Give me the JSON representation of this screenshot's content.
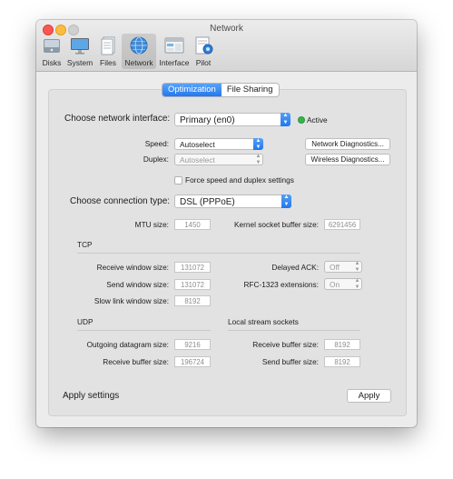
{
  "window": {
    "title": "Network"
  },
  "toolbar": [
    {
      "label": "Disks"
    },
    {
      "label": "System"
    },
    {
      "label": "Files"
    },
    {
      "label": "Network"
    },
    {
      "label": "Interface"
    },
    {
      "label": "Pilot"
    }
  ],
  "tabs": {
    "optimization": "Optimization",
    "file_sharing": "File Sharing"
  },
  "interface": {
    "label": "Choose network interface:",
    "value": "Primary (en0)",
    "status": "Active",
    "status_color": "#37b449"
  },
  "speed": {
    "label": "Speed:",
    "value": "Autoselect"
  },
  "duplex": {
    "label": "Duplex:",
    "value": "Autoselect"
  },
  "buttons": {
    "network_diag": "Network Diagnostics...",
    "wireless_diag": "Wireless Diagnostics...",
    "apply": "Apply"
  },
  "force_label": "Force speed and duplex settings",
  "connection": {
    "label": "Choose connection type:",
    "value": "DSL (PPPoE)"
  },
  "mtu": {
    "label": "MTU size:",
    "value": "1450"
  },
  "kernel": {
    "label": "Kernel socket buffer size:",
    "value": "6291456"
  },
  "tcp": {
    "heading": "TCP",
    "receive": {
      "label": "Receive window size:",
      "value": "131072"
    },
    "send": {
      "label": "Send window size:",
      "value": "131072"
    },
    "slow": {
      "label": "Slow link window size:",
      "value": "8192"
    },
    "delayed": {
      "label": "Delayed ACK:",
      "value": "Off"
    },
    "rfc": {
      "label": "RFC-1323 extensions:",
      "value": "On"
    }
  },
  "udp": {
    "heading": "UDP",
    "outgoing": {
      "label": "Outgoing datagram size:",
      "value": "9216"
    },
    "receive": {
      "label": "Receive buffer size:",
      "value": "196724"
    }
  },
  "local": {
    "heading": "Local stream sockets",
    "receive": {
      "label": "Receive buffer size:",
      "value": "8192"
    },
    "send": {
      "label": "Send buffer size:",
      "value": "8192"
    }
  },
  "apply_settings": "Apply settings",
  "accent": "#2178ef"
}
